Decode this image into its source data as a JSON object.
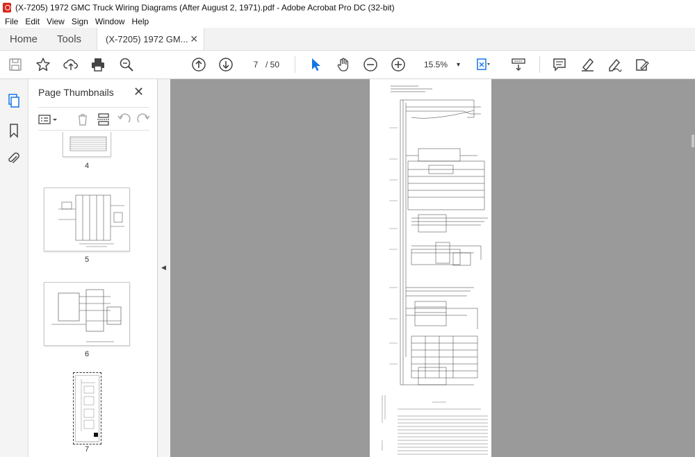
{
  "window": {
    "title": "(X-7205) 1972 GMC Truck Wiring Diagrams (After August 2, 1971).pdf - Adobe Acrobat Pro DC (32-bit)"
  },
  "menu": {
    "items": [
      "File",
      "Edit",
      "View",
      "Sign",
      "Window",
      "Help"
    ]
  },
  "tabs": {
    "home": "Home",
    "tools": "Tools",
    "document": "(X-7205) 1972 GM...",
    "close": "✕"
  },
  "toolbar": {
    "current_page": "7",
    "total_pages": "/ 50",
    "zoom": "15.5%",
    "zoom_caret": "▾"
  },
  "panel": {
    "title": "Page Thumbnails",
    "close": "✕",
    "thumbnails": [
      {
        "label": "4"
      },
      {
        "label": "5"
      },
      {
        "label": "6"
      },
      {
        "label": "7"
      }
    ]
  },
  "icons": {
    "save": "save-icon",
    "bookmark_star": "star-icon",
    "upload": "cloud-upload-icon",
    "print": "print-icon",
    "search": "search-zoom-icon",
    "prev_page": "arrow-up-icon",
    "next_page": "arrow-down-icon",
    "select": "cursor-arrow-icon",
    "hand": "hand-icon",
    "zoom_out": "zoom-out-icon",
    "zoom_in": "zoom-in-icon",
    "fit": "fit-page-icon",
    "scroll_mode": "scroll-mode-icon",
    "comment": "comment-icon",
    "highlight": "highlight-pen-icon",
    "draw": "draw-icon",
    "fill_sign": "fill-sign-icon"
  },
  "colors": {
    "accent": "#1473e6",
    "acrobat_red": "#d9261c",
    "doc_background": "#9a9a9a"
  }
}
